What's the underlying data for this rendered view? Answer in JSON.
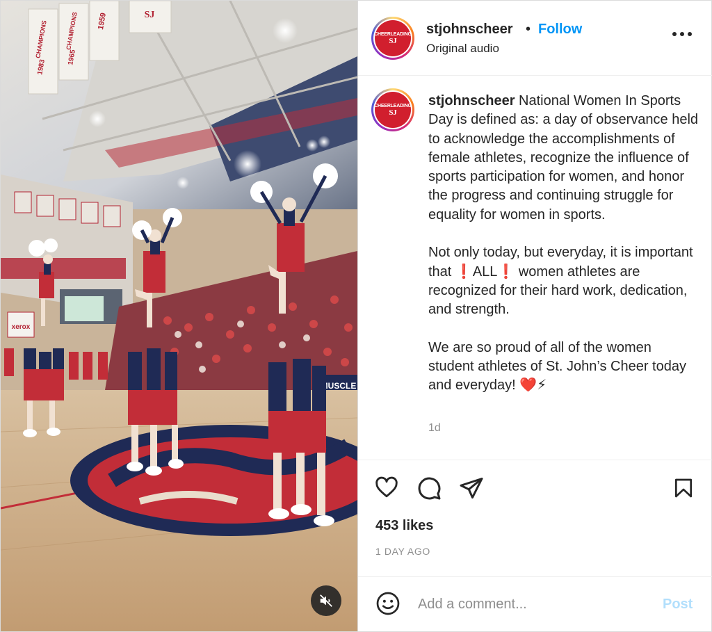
{
  "post": {
    "media": {
      "banners": [
        "CHAMPIONS",
        "CHAMPIONS",
        "1959",
        "SJ"
      ],
      "banner_years": [
        "1983",
        "1965"
      ],
      "board_text": "xerox",
      "ad_text": "MUSCLE",
      "mute_icon": "speaker-muted-icon"
    },
    "header": {
      "avatar_text": "CHEERLEADING",
      "avatar_mono": "SJ",
      "username": "stjohnscheer",
      "separator": "•",
      "follow_label": "Follow",
      "audio_label": "Original audio",
      "more_icon": "more-options-icon"
    },
    "caption": {
      "username": "stjohnscheer",
      "text": " National Women In Sports Day is defined as: a day of observance held to acknowledge the accomplishments of female athletes, recognize the influence of sports participation for women, and honor the progress and continuing struggle for equality for women in sports.\n\nNot only today, but everyday, it is important that ❗ALL❗ women athletes are recognized for their hard work, dedication, and strength.\n\nWe are so proud of all of the women student athletes of St. John’s Cheer today and everyday! ❤️⚡",
      "time": "1d"
    },
    "actions": {
      "like_icon": "heart-icon",
      "comment_icon": "comment-icon",
      "share_icon": "share-icon",
      "save_icon": "bookmark-icon"
    },
    "likes": "453 likes",
    "date": "1 DAY AGO",
    "comment_box": {
      "emoji_icon": "emoji-icon",
      "placeholder": "Add a comment...",
      "post_label": "Post"
    }
  },
  "colors": {
    "accent": "#0095f6",
    "post_disabled": "#b2dffc",
    "brand_red": "#d11f2e",
    "navy": "#1f2a55"
  }
}
